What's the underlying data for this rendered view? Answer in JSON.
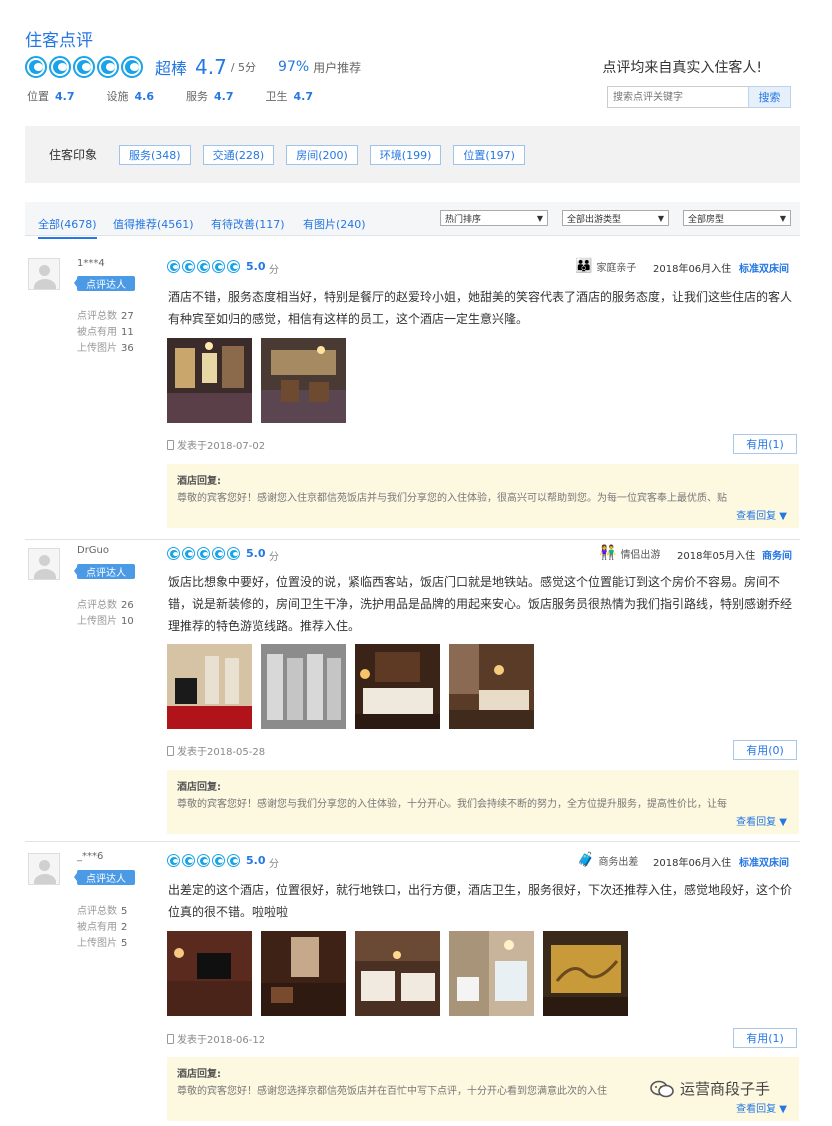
{
  "header": {
    "title": "住客点评",
    "rating_label": "超棒",
    "rating_score": "4.7",
    "rating_max": "/ 5分",
    "recommend_pct": "97%",
    "recommend_label": "用户推荐",
    "sub_ratings": [
      {
        "label": "位置",
        "value": "4.7"
      },
      {
        "label": "设施",
        "value": "4.6"
      },
      {
        "label": "服务",
        "value": "4.7"
      },
      {
        "label": "卫生",
        "value": "4.7"
      }
    ],
    "real_guest_text": "点评均来自真实入住客人!",
    "search_placeholder": "搜索点评关键字",
    "search_button": "搜索"
  },
  "impressions": {
    "label": "住客印象",
    "tags": [
      "服务(348)",
      "交通(228)",
      "房间(200)",
      "环境(199)",
      "位置(197)"
    ]
  },
  "tabs": {
    "items": [
      "全部(4678)",
      "值得推荐(4561)",
      "有待改善(117)",
      "有图片(240)"
    ],
    "selects": [
      "热门排序",
      "全部出游类型",
      "全部房型"
    ]
  },
  "reviews": [
    {
      "username": "1***4",
      "badge": "点评达人",
      "stats": [
        {
          "label": "点评总数",
          "value": "27"
        },
        {
          "label": "被点有用",
          "value": "11"
        },
        {
          "label": "上传图片",
          "value": "36"
        }
      ],
      "score": "5.0",
      "score_unit": "分",
      "trip_type": "家庭亲子",
      "checkin": "2018年06月入住",
      "room_type": "标准双床间",
      "text": "酒店不错，服务态度相当好，特别是餐厅的赵爱玲小姐，她甜美的笑容代表了酒店的服务态度，让我们这些住店的客人有种宾至如归的感觉，相信有这样的员工，这个酒店一定生意兴隆。",
      "posted": "发表于2018-07-02",
      "useful": "有用(1)",
      "reply_title": "酒店回复:",
      "reply_text": "尊敬的宾客您好！感谢您入住京都信苑饭店并与我们分享您的入住体验，很高兴可以帮助到您。为每一位宾客奉上最优质、贴",
      "reply_more": "查看回复 ▼",
      "photos": 2
    },
    {
      "username": "DrGuo",
      "badge": "点评达人",
      "stats": [
        {
          "label": "点评总数",
          "value": "26"
        },
        {
          "label": "上传图片",
          "value": "10"
        }
      ],
      "score": "5.0",
      "score_unit": "分",
      "trip_type": "情侣出游",
      "checkin": "2018年05月入住",
      "room_type": "商务间",
      "text": "饭店比想象中要好，位置没的说，紧临西客站，饭店门口就是地铁站。感觉这个位置能订到这个房价不容易。房间不错，说是新装修的，房间卫生干净，洗护用品是品牌的用起来安心。饭店服务员很热情为我们指引路线，特别感谢乔经理推荐的特色游览线路。推荐入住。",
      "posted": "发表于2018-05-28",
      "useful": "有用(0)",
      "reply_title": "酒店回复:",
      "reply_text": "尊敬的宾客您好！感谢您与我们分享您的入住体验，十分开心。我们会持续不断的努力，全方位提升服务，提高性价比，让每",
      "reply_more": "查看回复 ▼",
      "photos": 4
    },
    {
      "username": "_***6",
      "badge": "点评达人",
      "stats": [
        {
          "label": "点评总数",
          "value": "5"
        },
        {
          "label": "被点有用",
          "value": "2"
        },
        {
          "label": "上传图片",
          "value": "5"
        }
      ],
      "score": "5.0",
      "score_unit": "分",
      "trip_type": "商务出差",
      "checkin": "2018年06月入住",
      "room_type": "标准双床间",
      "text": "出差定的这个酒店，位置很好，就行地铁口，出行方便，酒店卫生，服务很好，下次还推荐入住，感觉地段好，这个价位真的很不错。啦啦啦",
      "posted": "发表于2018-06-12",
      "useful": "有用(1)",
      "reply_title": "酒店回复:",
      "reply_text": "尊敬的宾客您好！感谢您选择京都信苑饭店并在百忙中写下点评，十分开心看到您满意此次的入住",
      "reply_more": "查看回复 ▼",
      "photos": 5
    }
  ],
  "watermark": "运营商段子手",
  "colors": {
    "accent": "#2577e3",
    "circle": "#1aa3e8",
    "reply_bg": "#fdf8e0"
  }
}
